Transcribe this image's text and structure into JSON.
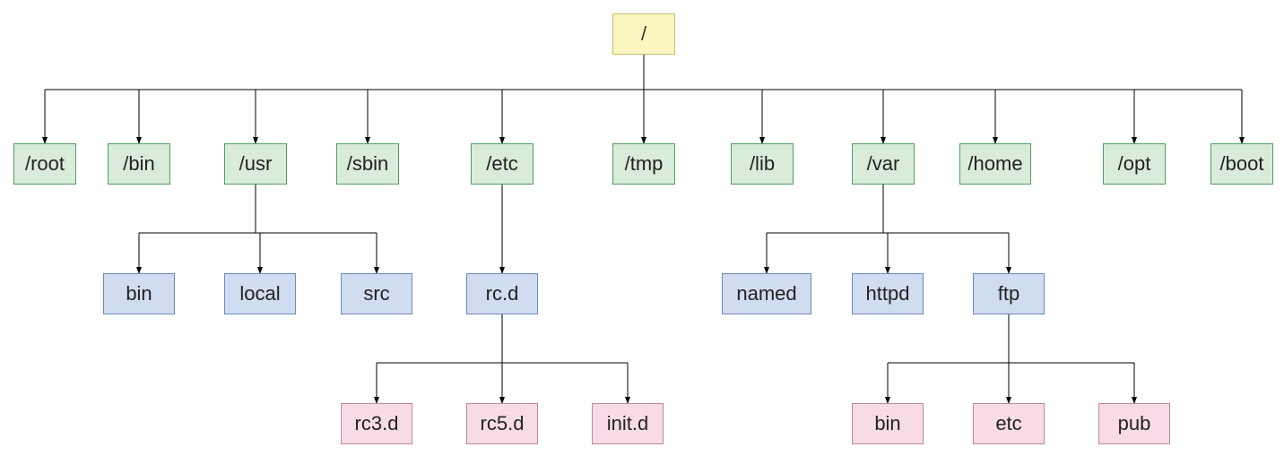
{
  "tree": {
    "root": {
      "label": "/"
    },
    "level1": [
      {
        "label": "/root"
      },
      {
        "label": "/bin"
      },
      {
        "label": "/usr"
      },
      {
        "label": "/sbin"
      },
      {
        "label": "/etc"
      },
      {
        "label": "/tmp"
      },
      {
        "label": "/lib"
      },
      {
        "label": "/var"
      },
      {
        "label": "/home"
      },
      {
        "label": "/opt"
      },
      {
        "label": "/boot"
      }
    ],
    "usr_children": [
      {
        "label": "bin"
      },
      {
        "label": "local"
      },
      {
        "label": "src"
      }
    ],
    "etc_children": [
      {
        "label": "rc.d"
      }
    ],
    "rcd_children": [
      {
        "label": "rc3.d"
      },
      {
        "label": "rc5.d"
      },
      {
        "label": "init.d"
      }
    ],
    "var_children": [
      {
        "label": "named"
      },
      {
        "label": "httpd"
      },
      {
        "label": "ftp"
      }
    ],
    "ftp_children": [
      {
        "label": "bin"
      },
      {
        "label": "etc"
      },
      {
        "label": "pub"
      }
    ]
  },
  "colors": {
    "root_bg": "#fbf6c0",
    "level1_bg": "#d9ecd9",
    "level2_bg": "#d0dcf0",
    "level3_bg": "#f7dbe6"
  }
}
